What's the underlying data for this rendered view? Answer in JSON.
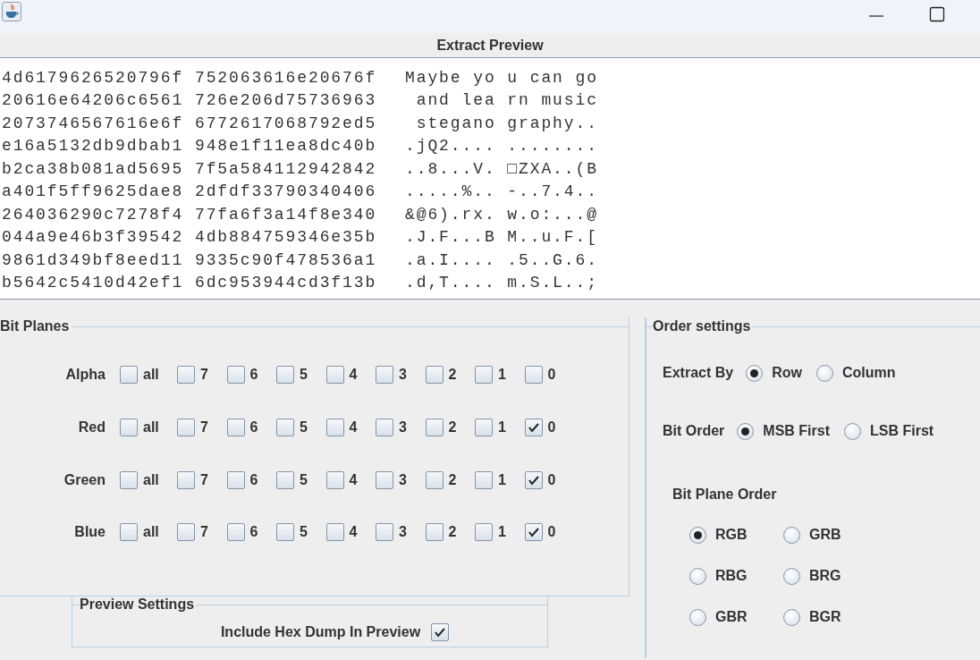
{
  "preview": {
    "title": "Extract Preview",
    "rows": [
      {
        "hex": "4d6179626520796f 752063616e20676f",
        "ascii": "Maybe yo u can go"
      },
      {
        "hex": "20616e64206c6561 726e206d75736963",
        "ascii": " and lea rn music"
      },
      {
        "hex": "2073746567616e6f 6772617068792ed5",
        "ascii": " stegano graphy.."
      },
      {
        "hex": "e16a5132db9dbab1 948e1f11ea8dc40b",
        "ascii": ".jQ2.... ........"
      },
      {
        "hex": "b2ca38b081ad5695 7f5a584112942842",
        "ascii": "..8...V. □ZXA..(B"
      },
      {
        "hex": "a401f5ff9625dae8 2dfdf33790340406",
        "ascii": ".....%.. -..7.4.."
      },
      {
        "hex": "264036290c7278f4 77fa6f3a14f8e340",
        "ascii": "&@6).rx. w.o:...@"
      },
      {
        "hex": "044a9e46b3f39542 4db884759346e35b",
        "ascii": ".J.F...B M..u.F.["
      },
      {
        "hex": "9861d349bf8eed11 9335c90f478536a1",
        "ascii": ".a.I.... .5..G.6."
      },
      {
        "hex": "b5642c5410d42ef1 6dc953944cd3f13b",
        "ascii": ".d,T.... m.S.L..;"
      }
    ]
  },
  "bit_planes": {
    "title": "Bit Planes",
    "channels": [
      {
        "label": "Alpha",
        "bits": [
          {
            "label": "all",
            "checked": false
          },
          {
            "label": "7",
            "checked": false
          },
          {
            "label": "6",
            "checked": false
          },
          {
            "label": "5",
            "checked": false
          },
          {
            "label": "4",
            "checked": false
          },
          {
            "label": "3",
            "checked": false
          },
          {
            "label": "2",
            "checked": false
          },
          {
            "label": "1",
            "checked": false
          },
          {
            "label": "0",
            "checked": false
          }
        ]
      },
      {
        "label": "Red",
        "bits": [
          {
            "label": "all",
            "checked": false
          },
          {
            "label": "7",
            "checked": false
          },
          {
            "label": "6",
            "checked": false
          },
          {
            "label": "5",
            "checked": false
          },
          {
            "label": "4",
            "checked": false
          },
          {
            "label": "3",
            "checked": false
          },
          {
            "label": "2",
            "checked": false
          },
          {
            "label": "1",
            "checked": false
          },
          {
            "label": "0",
            "checked": true
          }
        ]
      },
      {
        "label": "Green",
        "bits": [
          {
            "label": "all",
            "checked": false
          },
          {
            "label": "7",
            "checked": false
          },
          {
            "label": "6",
            "checked": false
          },
          {
            "label": "5",
            "checked": false
          },
          {
            "label": "4",
            "checked": false
          },
          {
            "label": "3",
            "checked": false
          },
          {
            "label": "2",
            "checked": false
          },
          {
            "label": "1",
            "checked": false
          },
          {
            "label": "0",
            "checked": true
          }
        ]
      },
      {
        "label": "Blue",
        "bits": [
          {
            "label": "all",
            "checked": false
          },
          {
            "label": "7",
            "checked": false
          },
          {
            "label": "6",
            "checked": false
          },
          {
            "label": "5",
            "checked": false
          },
          {
            "label": "4",
            "checked": false
          },
          {
            "label": "3",
            "checked": false
          },
          {
            "label": "2",
            "checked": false
          },
          {
            "label": "1",
            "checked": false
          },
          {
            "label": "0",
            "checked": true
          }
        ]
      }
    ]
  },
  "preview_settings": {
    "title": "Preview Settings",
    "options": [
      {
        "label": "Include Hex Dump In Preview",
        "checked": true
      }
    ]
  },
  "order_settings": {
    "title": "Order settings",
    "extract_by": {
      "label": "Extract By",
      "options": [
        {
          "label": "Row",
          "selected": true
        },
        {
          "label": "Column",
          "selected": false
        }
      ]
    },
    "bit_order": {
      "label": "Bit Order",
      "options": [
        {
          "label": "MSB First",
          "selected": true
        },
        {
          "label": "LSB First",
          "selected": false
        }
      ]
    },
    "bit_plane_order": {
      "label": "Bit Plane Order",
      "options": [
        {
          "label": "RGB",
          "selected": true
        },
        {
          "label": "GRB",
          "selected": false
        },
        {
          "label": "RBG",
          "selected": false
        },
        {
          "label": "BRG",
          "selected": false
        },
        {
          "label": "GBR",
          "selected": false
        },
        {
          "label": "BGR",
          "selected": false
        }
      ]
    }
  }
}
